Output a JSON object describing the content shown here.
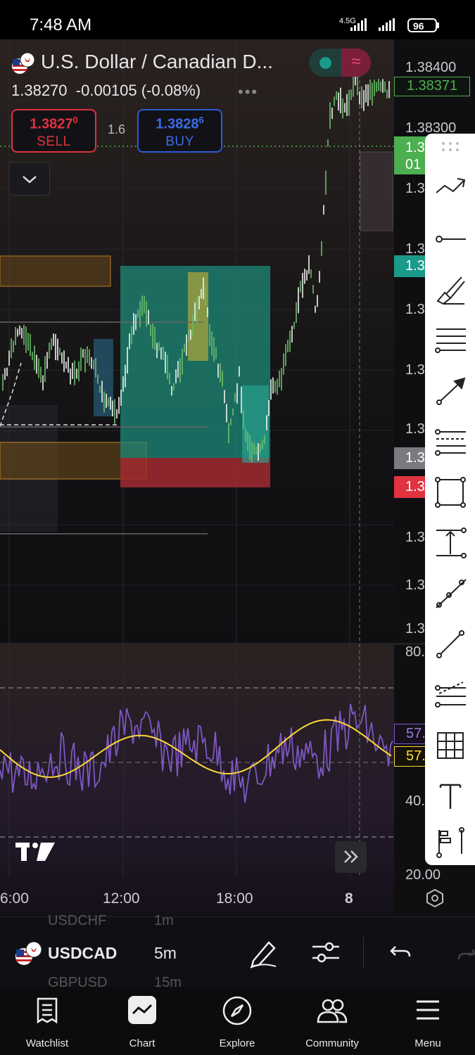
{
  "status_bar": {
    "time": "7:48 AM",
    "network": "4.5G",
    "battery": "96"
  },
  "chart": {
    "symbol_title": "U.S. Dollar / Canadian D...",
    "last_price": "1.38270",
    "change": "-0.00105 (-0.08%)",
    "sell": {
      "price": "1.3827",
      "price_small": "0",
      "label": "SELL"
    },
    "buy": {
      "price": "1.3828",
      "price_small": "6",
      "label": "BUY"
    },
    "spread": "1.6",
    "price_axis": [
      "1.38400",
      "1.38300",
      "1.3",
      "1.3",
      "1.3",
      "1.3",
      "1.3",
      "1.3",
      "1.3",
      "1.3"
    ],
    "current_price_tag": "1.38371",
    "green_tag_1": "1.3",
    "green_tag_2": "01",
    "teal_tag": "1.3",
    "gray_tag": "1.3",
    "red_tag": "1.3",
    "oscillator_axis": [
      "80.",
      "40.",
      "20.00"
    ],
    "osc_tag_purple": "57.",
    "osc_tag_yellow": "57.",
    "time_axis": [
      "6:00",
      "12:00",
      "18:00",
      "8"
    ],
    "colors": {
      "up": "#26a69a",
      "down": "#ef5350",
      "accent": "#2962ff",
      "rsi": "#7e57c2",
      "rsi_ma": "#fdd835"
    }
  },
  "bottom_toolbar": {
    "symbol": "USDCAD",
    "interval": "5m",
    "ghost_above": {
      "symbol": "USDCHF",
      "interval": "1m"
    },
    "ghost_below": {
      "symbol": "GBPUSD",
      "interval": "15m"
    }
  },
  "nav": [
    {
      "label": "Watchlist",
      "icon": "watchlist-icon"
    },
    {
      "label": "Chart",
      "icon": "chart-icon"
    },
    {
      "label": "Explore",
      "icon": "compass-icon"
    },
    {
      "label": "Community",
      "icon": "community-icon"
    },
    {
      "label": "Menu",
      "icon": "menu-icon"
    }
  ]
}
